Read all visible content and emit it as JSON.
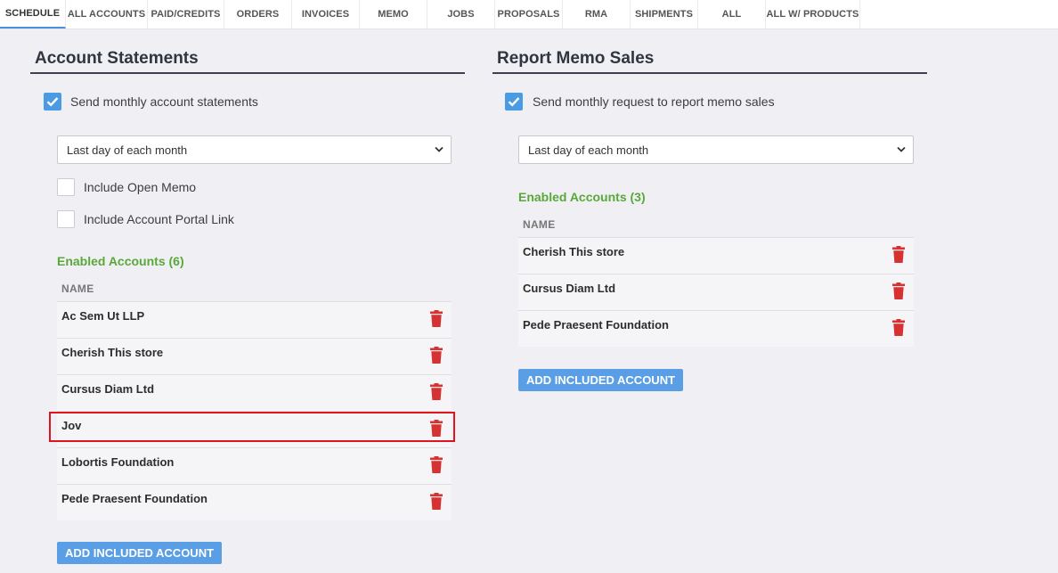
{
  "tabs": [
    {
      "label": "SCHEDULE",
      "active": true
    },
    {
      "label": "ALL ACCOUNTS"
    },
    {
      "label": "PAID/CREDITS"
    },
    {
      "label": "ORDERS"
    },
    {
      "label": "INVOICES"
    },
    {
      "label": "MEMO"
    },
    {
      "label": "JOBS"
    },
    {
      "label": "PROPOSALS"
    },
    {
      "label": "RMA"
    },
    {
      "label": "SHIPMENTS"
    },
    {
      "label": "ALL"
    },
    {
      "label": "ALL W/ PRODUCTS"
    }
  ],
  "account_statements": {
    "title": "Account Statements",
    "send_label": "Send monthly account statements",
    "send_checked": true,
    "schedule_select": "Last day of each month",
    "include_open_memo": "Include Open Memo",
    "include_portal_link": "Include Account Portal Link",
    "enabled_title": "Enabled Accounts (6)",
    "col_name": "NAME",
    "accounts": [
      "Ac Sem Ut LLP",
      "Cherish This store",
      "Cursus Diam Ltd",
      "Jov",
      "Lobortis Foundation",
      "Pede Praesent Foundation"
    ],
    "add_button": "ADD INCLUDED ACCOUNT"
  },
  "report_memo_sales": {
    "title": "Report Memo Sales",
    "send_label": "Send monthly request to report memo sales",
    "send_checked": true,
    "schedule_select": "Last day of each month",
    "enabled_title": "Enabled Accounts (3)",
    "col_name": "NAME",
    "accounts": [
      "Cherish This store",
      "Cursus Diam Ltd",
      "Pede Praesent Foundation"
    ],
    "add_button": "ADD INCLUDED ACCOUNT"
  },
  "colors": {
    "accent": "#4a9be4",
    "enabled_green": "#5aa83a",
    "delete_red": "#d63232",
    "highlight_red": "#e0141f"
  }
}
